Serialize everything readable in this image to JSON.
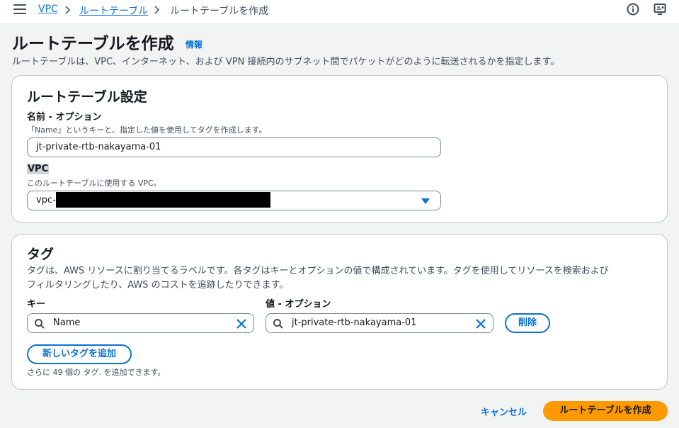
{
  "breadcrumb": {
    "items": [
      "VPC",
      "ルートテーブル"
    ],
    "current": "ルートテーブルを作成"
  },
  "icons": {
    "menu": "hamburger-icon",
    "info": "info-circle-icon",
    "notifications": "notification-monitor-icon",
    "separator": "chevron-right-icon",
    "search": "search-icon",
    "clear": "close-icon",
    "dropdown": "caret-down-icon"
  },
  "page": {
    "title": "ルートテーブルを作成",
    "info": "情報",
    "description": "ルートテーブルは、VPC、インターネット、および VPN 接続内のサブネット間でパケットがどのように転送されるかを指定します。"
  },
  "settings": {
    "title": "ルートテーブル設定",
    "name_label": "名前 - オプション",
    "name_desc": "「Name」というキーと、指定した値を使用してタグを作成します。",
    "name_value": "jt-private-rtb-nakayama-01",
    "vpc_label": "VPC",
    "vpc_desc": "このルートテーブルに使用する VPC。",
    "vpc_value": "vpc-0"
  },
  "tags": {
    "title": "タグ",
    "description_line1": "タグは、AWS リソースに割り当てるラベルです。各タグはキーとオプションの値で構成されています。タグを使用してリソースを検索および",
    "description_line2": "フィルタリングしたり、AWS のコストを追跡したりできます。",
    "key_label": "キー",
    "value_label": "値 - オプション",
    "rows": [
      {
        "key": "Name",
        "value": "jt-private-rtb-nakayama-01"
      }
    ],
    "remove_label": "削除",
    "add_label": "新しいタグを追加",
    "remaining": "さらに 49 個の タグ. を追加できます。"
  },
  "footer": {
    "cancel": "キャンセル",
    "create": "ルートテーブルを作成"
  },
  "colors": {
    "accent": "#0972d3",
    "primary": "#ff9900",
    "background": "#f2f3f3"
  }
}
